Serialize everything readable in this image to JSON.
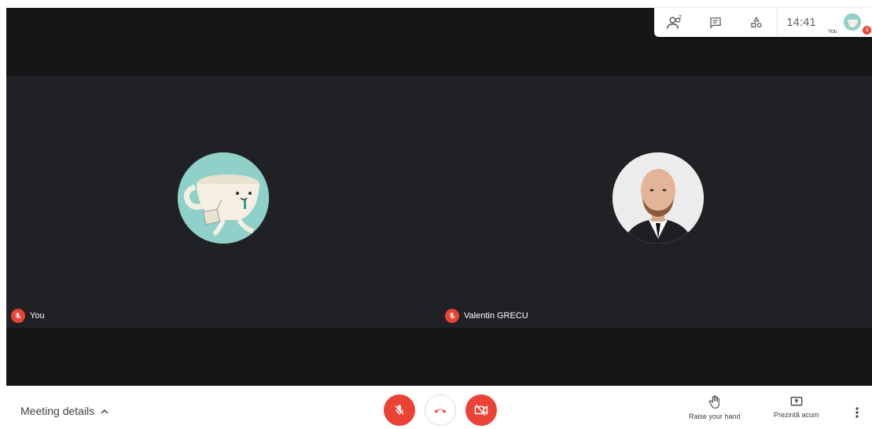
{
  "topbar": {
    "people_count": "2",
    "time": "14:41",
    "me_label": "You",
    "notification_count": "3"
  },
  "tiles": [
    {
      "name": "You",
      "avatar": "teacup-avatar"
    },
    {
      "name": "Valentin GRECU",
      "avatar": "person-photo"
    }
  ],
  "bottom": {
    "meeting_details": "Meeting details",
    "raise_hand": "Raise your hand",
    "present_now": "Prezintă acum"
  },
  "colors": {
    "stage_bg": "#151618",
    "tile_bg": "#202124",
    "danger": "#ea4335"
  }
}
